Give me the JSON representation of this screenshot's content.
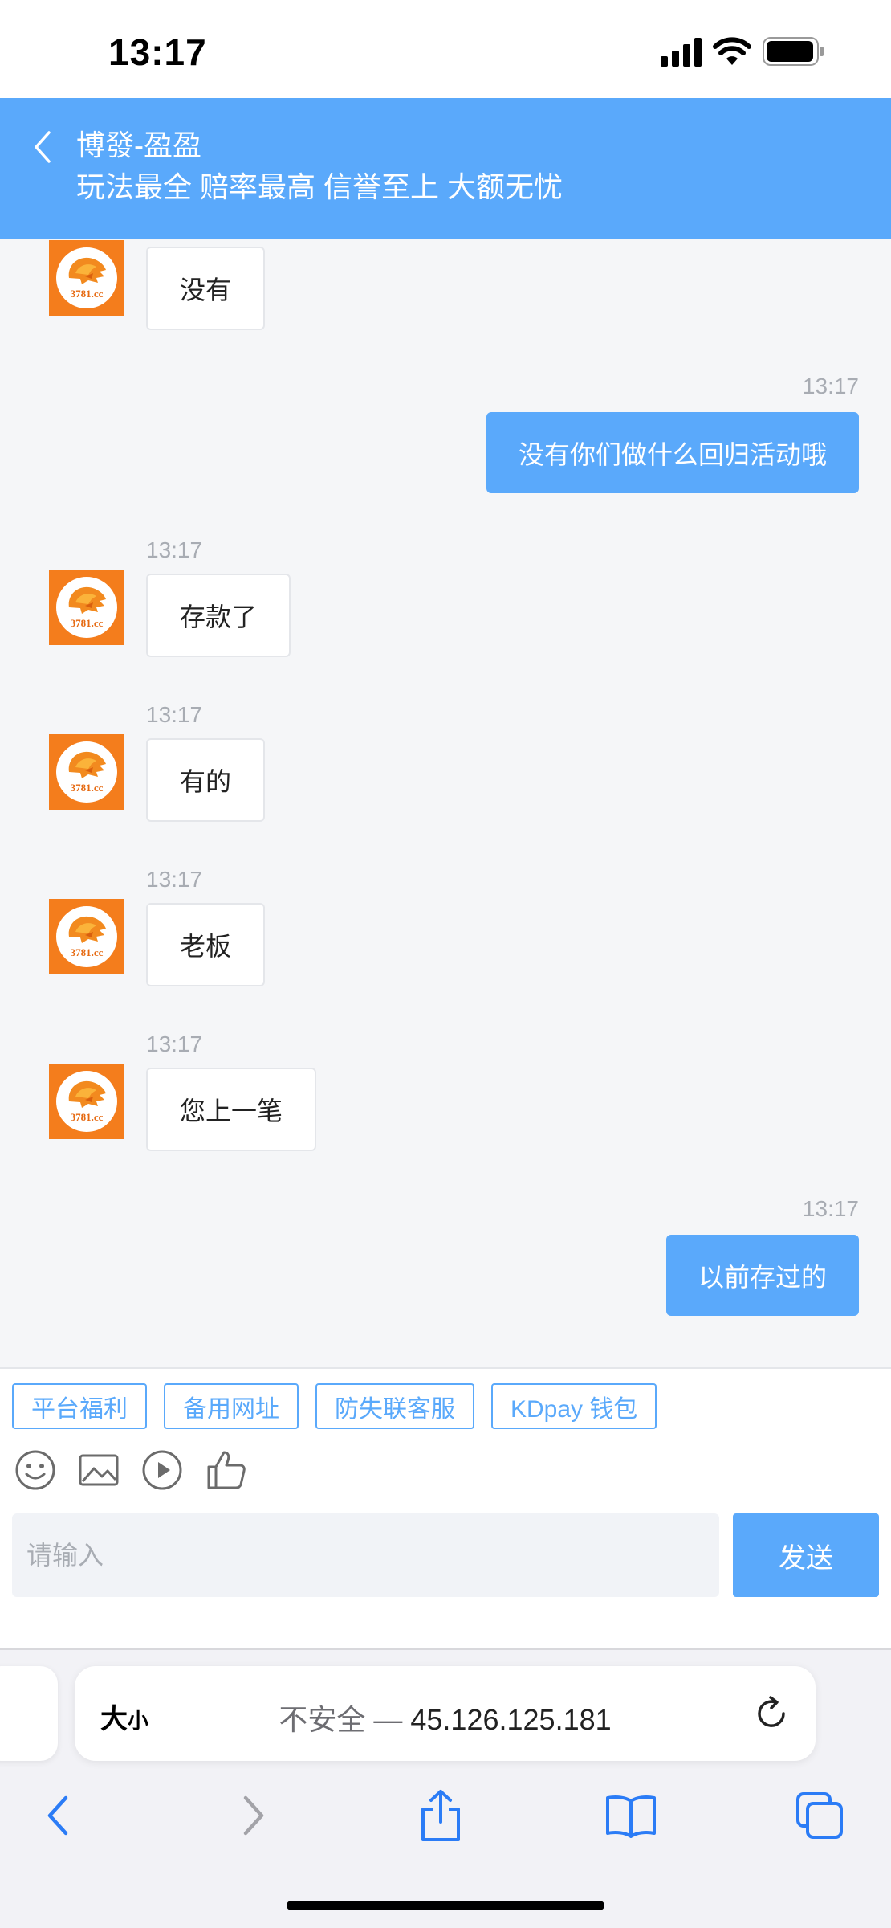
{
  "status_bar": {
    "time": "13:17"
  },
  "header": {
    "title": "博發-盈盈",
    "subtitle": "玩法最全 赔率最高 信誉至上 大额无忧"
  },
  "avatar": {
    "domain": "3781.cc"
  },
  "messages": [
    {
      "side": "left",
      "time": "",
      "text": "没有"
    },
    {
      "side": "right",
      "time": "13:17",
      "text": "没有你们做什么回归活动哦"
    },
    {
      "side": "left",
      "time": "13:17",
      "text": "存款了"
    },
    {
      "side": "left",
      "time": "13:17",
      "text": "有的"
    },
    {
      "side": "left",
      "time": "13:17",
      "text": "老板"
    },
    {
      "side": "left",
      "time": "13:17",
      "text": "您上一笔"
    },
    {
      "side": "right",
      "time": "13:17",
      "text": "以前存过的"
    }
  ],
  "quick_actions": [
    "平台福利",
    "备用网址",
    "防失联客服",
    "KDpay 钱包"
  ],
  "tools": [
    "emoji-icon",
    "image-icon",
    "video-icon",
    "thumbs-up-icon"
  ],
  "input": {
    "placeholder": "请输入",
    "value": ""
  },
  "send_label": "发送",
  "browser": {
    "text_size_big": "大",
    "text_size_small": "小",
    "insecure_label": "不安全 —",
    "url": "45.126.125.181"
  },
  "colors": {
    "accent": "#5aa9fb",
    "avatar_bg": "#f47d1c"
  }
}
